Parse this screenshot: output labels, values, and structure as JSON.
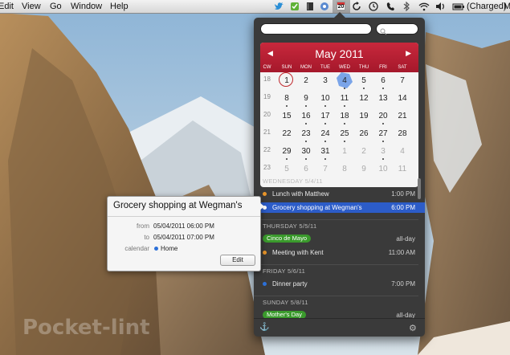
{
  "menubar": {
    "menus": [
      {
        "label": "Edit"
      },
      {
        "label": "View"
      },
      {
        "label": "Go"
      },
      {
        "label": "Window"
      },
      {
        "label": "Help"
      }
    ],
    "date_badge": "20",
    "battery_label": "(Charged)",
    "user_label": "M",
    "icons": [
      "twitter-icon",
      "evernote-icon",
      "dropbox-icon",
      "book-icon",
      "sync-icon",
      "fantastical-icon",
      "refresh-icon",
      "time-machine-icon",
      "phone-icon",
      "bluetooth-icon",
      "wifi-icon",
      "volume-icon",
      "battery-icon"
    ]
  },
  "panel": {
    "event_input": {
      "value": "",
      "placeholder": ""
    },
    "search_input": {
      "value": "",
      "placeholder": ""
    },
    "calendar": {
      "month_title": "May 2011",
      "prev_label": "◀",
      "next_label": "▶",
      "weekday_headers": [
        "CW",
        "SUN",
        "MON",
        "TUE",
        "WED",
        "THU",
        "FRI",
        "SAT"
      ],
      "weeks": [
        {
          "cw": "18",
          "days": [
            {
              "d": "1",
              "other": false,
              "dot": false
            },
            {
              "d": "2",
              "other": false,
              "dot": false
            },
            {
              "d": "3",
              "other": false,
              "dot": false
            },
            {
              "d": "4",
              "other": false,
              "dot": true
            },
            {
              "d": "5",
              "other": false,
              "dot": true
            },
            {
              "d": "6",
              "other": false,
              "dot": true
            },
            {
              "d": "7",
              "other": false,
              "dot": false
            }
          ]
        },
        {
          "cw": "19",
          "days": [
            {
              "d": "8",
              "other": false,
              "dot": true
            },
            {
              "d": "9",
              "other": false,
              "dot": true
            },
            {
              "d": "10",
              "other": false,
              "dot": true
            },
            {
              "d": "11",
              "other": false,
              "dot": true
            },
            {
              "d": "12",
              "other": false,
              "dot": false
            },
            {
              "d": "13",
              "other": false,
              "dot": false
            },
            {
              "d": "14",
              "other": false,
              "dot": false
            }
          ]
        },
        {
          "cw": "20",
          "days": [
            {
              "d": "15",
              "other": false,
              "dot": false
            },
            {
              "d": "16",
              "other": false,
              "dot": true
            },
            {
              "d": "17",
              "other": false,
              "dot": true
            },
            {
              "d": "18",
              "other": false,
              "dot": true
            },
            {
              "d": "19",
              "other": false,
              "dot": false
            },
            {
              "d": "20",
              "other": false,
              "dot": true
            },
            {
              "d": "21",
              "other": false,
              "dot": false
            }
          ]
        },
        {
          "cw": "21",
          "days": [
            {
              "d": "22",
              "other": false,
              "dot": false
            },
            {
              "d": "23",
              "other": false,
              "dot": true
            },
            {
              "d": "24",
              "other": false,
              "dot": true
            },
            {
              "d": "25",
              "other": false,
              "dot": true
            },
            {
              "d": "26",
              "other": false,
              "dot": false
            },
            {
              "d": "27",
              "other": false,
              "dot": true
            },
            {
              "d": "28",
              "other": false,
              "dot": false
            }
          ]
        },
        {
          "cw": "22",
          "days": [
            {
              "d": "29",
              "other": false,
              "dot": true
            },
            {
              "d": "30",
              "other": false,
              "dot": true
            },
            {
              "d": "31",
              "other": false,
              "dot": true
            },
            {
              "d": "1",
              "other": true,
              "dot": false
            },
            {
              "d": "2",
              "other": true,
              "dot": false
            },
            {
              "d": "3",
              "other": true,
              "dot": true
            },
            {
              "d": "4",
              "other": true,
              "dot": false
            }
          ]
        },
        {
          "cw": "23",
          "days": [
            {
              "d": "5",
              "other": true,
              "dot": false
            },
            {
              "d": "6",
              "other": true,
              "dot": false
            },
            {
              "d": "7",
              "other": true,
              "dot": false
            },
            {
              "d": "8",
              "other": true,
              "dot": false
            },
            {
              "d": "9",
              "other": true,
              "dot": false
            },
            {
              "d": "10",
              "other": true,
              "dot": false
            },
            {
              "d": "11",
              "other": true,
              "dot": false
            }
          ]
        }
      ],
      "today_day": "1",
      "selected_day": "4"
    },
    "agenda": {
      "sections": [
        {
          "heading": "WEDNESDAY 5/4/11",
          "events": [
            {
              "title": "Lunch with Matthew",
              "time": "1:00 PM",
              "color": "#e8952a",
              "kind": "timed",
              "selected": false
            },
            {
              "title": "Grocery shopping at Wegman's",
              "time": "6:00 PM",
              "color": "#ffffff",
              "kind": "timed",
              "selected": true
            }
          ]
        },
        {
          "heading": "THURSDAY 5/5/11",
          "events": [
            {
              "title": "Cinco de Mayo",
              "time": "all-day",
              "color": "#3a9a2c",
              "kind": "allday",
              "selected": false
            },
            {
              "title": "Meeting with Kent",
              "time": "11:00 AM",
              "color": "#e8952a",
              "kind": "timed",
              "selected": false
            }
          ]
        },
        {
          "heading": "FRIDAY 5/6/11",
          "events": [
            {
              "title": "Dinner party",
              "time": "7:00 PM",
              "color": "#2c70d8",
              "kind": "timed",
              "selected": false
            }
          ]
        },
        {
          "heading": "SUNDAY 5/8/11",
          "events": [
            {
              "title": "Mother's Day",
              "time": "all-day",
              "color": "#3a9a2c",
              "kind": "allday",
              "selected": false
            }
          ]
        }
      ]
    }
  },
  "popover": {
    "title": "Grocery shopping at Wegman's",
    "from_label": "from",
    "from_value": "05/04/2011 06:00 PM",
    "to_label": "to",
    "to_value": "05/04/2011 07:00 PM",
    "calendar_label": "calendar",
    "calendar_value": "Home",
    "calendar_color": "#2c70d8",
    "edit_label": "Edit"
  },
  "watermark": "Pocket-lint"
}
